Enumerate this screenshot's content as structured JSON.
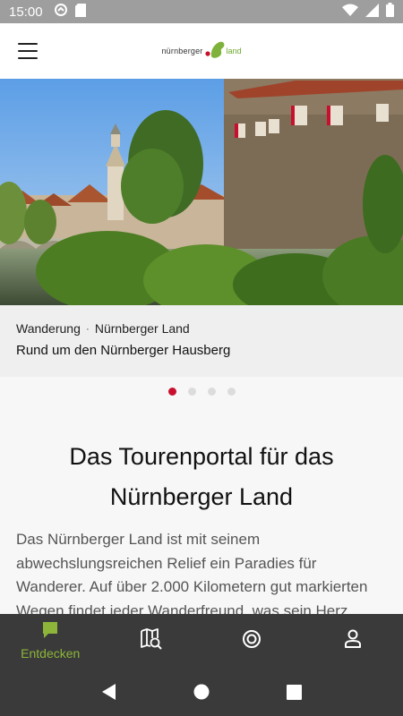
{
  "status_bar": {
    "time": "15:00"
  },
  "header": {
    "logo_text_left": "nürnberger",
    "logo_text_right": "land"
  },
  "hero": {
    "category": "Wanderung",
    "separator": "·",
    "region": "Nürnberger Land",
    "title": "Rund um den Nürnberger Hausberg",
    "slide_count": 4,
    "active_slide": 1
  },
  "main": {
    "headline": "Das Tourenportal für das Nürnberger Land",
    "intro": "Das Nürnberger Land ist mit seinem abwechslungsreichen Relief ein Paradies für Wanderer. Auf über 2.000 Kilometern gut markierten Wegen findet jeder Wanderfreund, was sein Herz begehrt."
  },
  "bottom_nav": {
    "items": [
      {
        "label": "Entdecken",
        "icon": "speech-bubble-icon",
        "active": true
      },
      {
        "label": "",
        "icon": "map-search-icon",
        "active": false
      },
      {
        "label": "",
        "icon": "target-icon",
        "active": false
      },
      {
        "label": "",
        "icon": "person-icon",
        "active": false
      }
    ]
  },
  "colors": {
    "accent_green": "#8db53a",
    "active_dot_red": "#c8102e",
    "nav_background": "#3a3a3a"
  }
}
